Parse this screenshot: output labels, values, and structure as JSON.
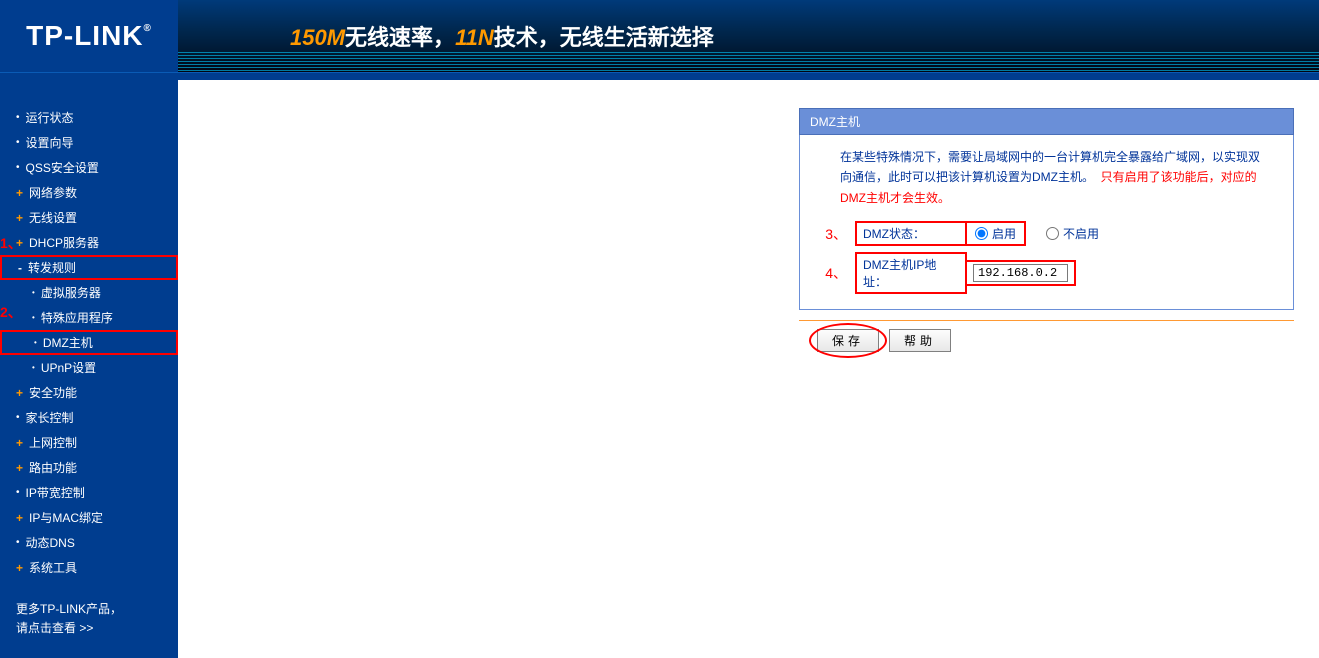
{
  "header": {
    "logo": "TP-LINK",
    "banner_speed": "150M",
    "banner_text1": "无线速率，",
    "banner_tech": "11N",
    "banner_text2": "技术，无线生活新选择"
  },
  "annotations": {
    "a1": "1、",
    "a2": "2、",
    "a3": "3、",
    "a4": "4、"
  },
  "sidebar": {
    "items": [
      {
        "label": "运行状态",
        "type": "bullet"
      },
      {
        "label": "设置向导",
        "type": "bullet"
      },
      {
        "label": "QSS安全设置",
        "type": "bullet"
      },
      {
        "label": "网络参数",
        "type": "plus"
      },
      {
        "label": "无线设置",
        "type": "plus"
      },
      {
        "label": "DHCP服务器",
        "type": "plus"
      },
      {
        "label": "转发规则",
        "type": "minus",
        "highlight": 1
      },
      {
        "label": "虚拟服务器",
        "type": "sub"
      },
      {
        "label": "特殊应用程序",
        "type": "sub"
      },
      {
        "label": "DMZ主机",
        "type": "sub",
        "highlight": 2
      },
      {
        "label": "UPnP设置",
        "type": "sub"
      },
      {
        "label": "安全功能",
        "type": "plus"
      },
      {
        "label": "家长控制",
        "type": "bullet"
      },
      {
        "label": "上网控制",
        "type": "plus"
      },
      {
        "label": "路由功能",
        "type": "plus"
      },
      {
        "label": "IP带宽控制",
        "type": "bullet"
      },
      {
        "label": "IP与MAC绑定",
        "type": "plus"
      },
      {
        "label": "动态DNS",
        "type": "bullet"
      },
      {
        "label": "系统工具",
        "type": "plus"
      }
    ],
    "promo_line1": "更多TP-LINK产品，",
    "promo_line2": "请点击查看 >>"
  },
  "panel": {
    "title": "DMZ主机",
    "help_text_blue": "在某些特殊情况下，需要让局域网中的一台计算机完全暴露给广域网，以实现双向通信，此时可以把该计算机设置为DMZ主机。",
    "help_text_red": "只有启用了该功能后，对应的DMZ主机才会生效。",
    "status_label": "DMZ状态：",
    "enable_label": "启用",
    "disable_label": "不启用",
    "ip_label": "DMZ主机IP地址：",
    "ip_value": "192.168.0.2",
    "save_btn": "保存",
    "help_btn": "帮助"
  }
}
